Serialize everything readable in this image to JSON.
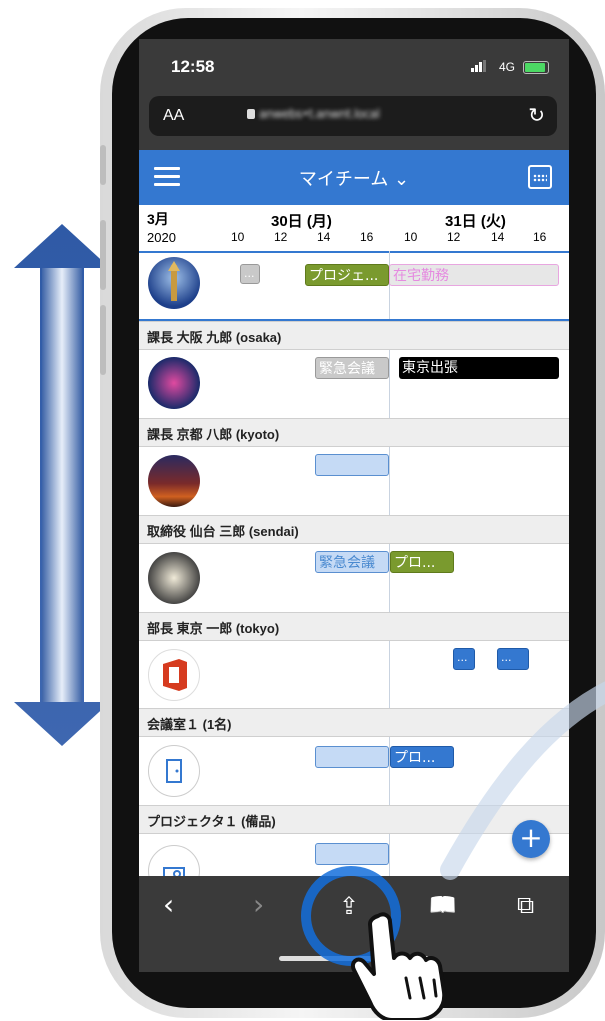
{
  "status": {
    "time": "12:58",
    "network": "4G"
  },
  "browser": {
    "text_size_label": "AA",
    "url": "anwebs•t.anwnt.local",
    "reload_icon": "reload-icon"
  },
  "appbar": {
    "title": "マイチーム ⌄",
    "menu_icon": "hamburger-icon",
    "calendar_icon": "calendar-icon"
  },
  "calendar": {
    "month": "3月",
    "year": "2020",
    "days": [
      "30日 (月)",
      "31日 (火)"
    ],
    "hours": [
      "10",
      "12",
      "14",
      "16",
      "10",
      "12",
      "14",
      "16"
    ]
  },
  "rows": [
    {
      "label": "",
      "events": [
        "...",
        "プロジェ...",
        "在宅勤務"
      ]
    },
    {
      "label": "課長 大阪 九郎 (osaka)",
      "events": [
        "緊急会議",
        "東京出張"
      ]
    },
    {
      "label": "課長 京都 八郎 (kyoto)",
      "events": [
        ""
      ]
    },
    {
      "label": "取締役 仙台 三郎 (sendai)",
      "events": [
        "緊急会議",
        "プロ..."
      ]
    },
    {
      "label": "部長 東京 一郎 (tokyo)",
      "events": [
        "...",
        "..."
      ]
    },
    {
      "label": "会議室１ (1名)",
      "events": [
        "",
        "プロ..."
      ]
    },
    {
      "label": "プロジェクタ１ (備品)",
      "events": [
        ""
      ]
    }
  ],
  "fab": {
    "label": "+"
  },
  "toolbar": {
    "back": "‹",
    "forward": "›",
    "share": "⇪",
    "bookmarks": "📖",
    "tabs": "⧉"
  },
  "colors": {
    "accent": "#3478d0",
    "green_event": "#7a9a2e",
    "chrome": "#3a3a3a"
  }
}
